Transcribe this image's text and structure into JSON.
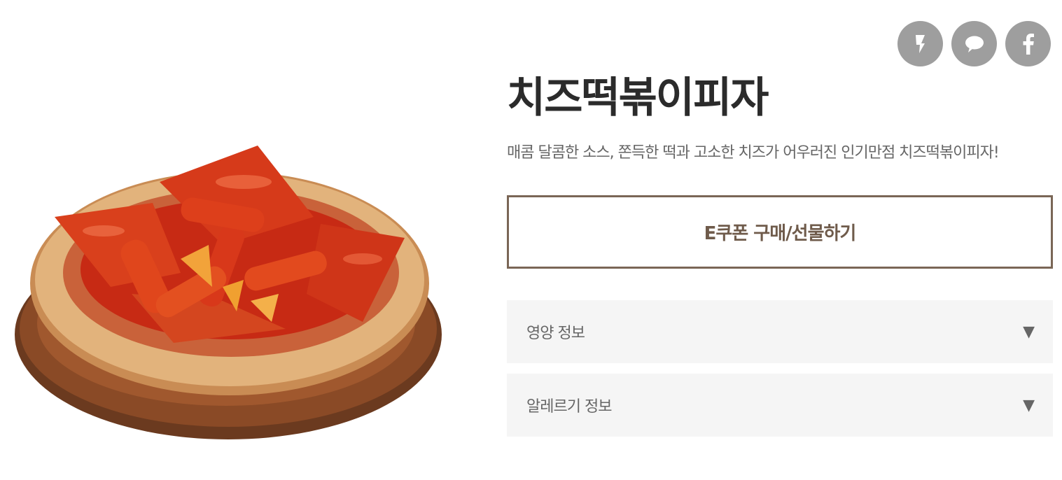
{
  "product": {
    "name": "치즈떡볶이피자",
    "description": "매콤 달콤한 소스, 쫀득한 떡과 고소한 치즈가 어우러진 인기만점 치즈떡볶이피자!",
    "image_alt": "치즈떡볶이피자"
  },
  "share": {
    "buttons": [
      {
        "icon": "kakaostory-icon"
      },
      {
        "icon": "kakaotalk-icon"
      },
      {
        "icon": "facebook-icon"
      }
    ]
  },
  "actions": {
    "ecoupon_label": "E쿠폰 구매/선물하기"
  },
  "accordions": [
    {
      "label": "영양 정보",
      "arrow": "▼"
    },
    {
      "label": "알레르기 정보",
      "arrow": "▼"
    }
  ],
  "colors": {
    "button_border": "#7a6656",
    "share_bg": "#9e9e9e",
    "accordion_bg": "#f5f5f5"
  }
}
